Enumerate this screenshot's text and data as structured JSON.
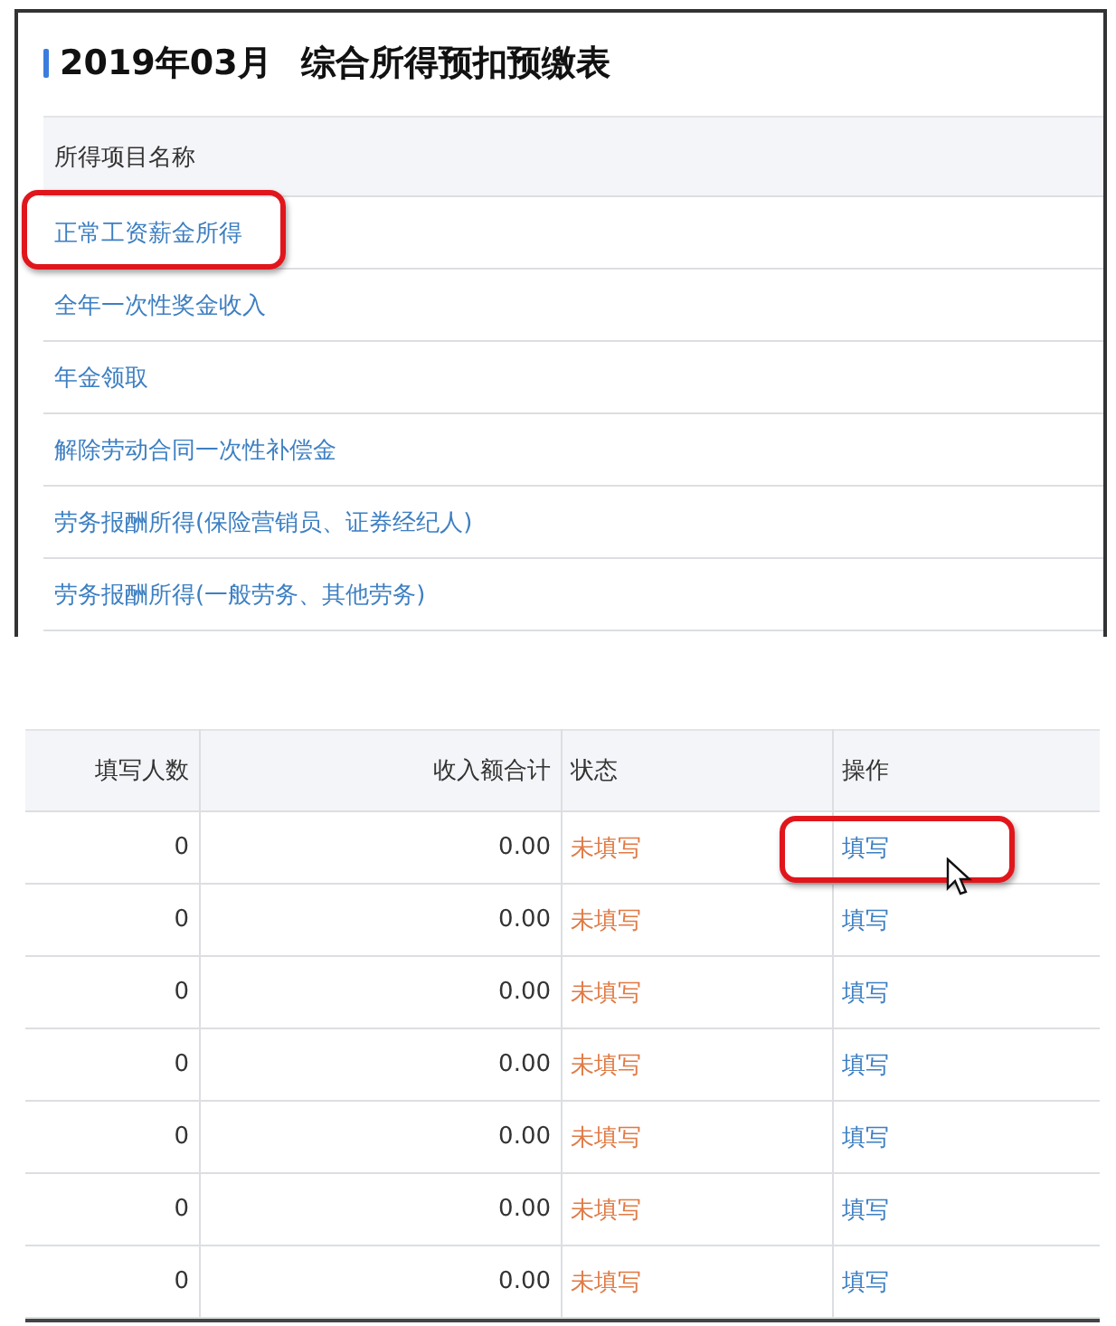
{
  "income_panel": {
    "title_period": "2019年03月",
    "title": "综合所得预扣预缴表",
    "column": "所得项目名称",
    "items": [
      {
        "label": "正常工资薪金所得",
        "highlighted": true
      },
      {
        "label": "全年一次性奖金收入",
        "highlighted": false
      },
      {
        "label": "年金领取",
        "highlighted": false
      },
      {
        "label": "解除劳动合同一次性补偿金",
        "highlighted": false
      },
      {
        "label": "劳务报酬所得(保险营销员、证券经纪人)",
        "highlighted": false
      },
      {
        "label": "劳务报酬所得(一般劳务、其他劳务)",
        "highlighted": false
      }
    ]
  },
  "summary_table": {
    "columns": [
      "填写人数",
      "收入额合计",
      "状态",
      "操作"
    ],
    "rows": [
      {
        "count": "0",
        "amount": "0.00",
        "status": "未填写",
        "action": "填写",
        "highlighted": true
      },
      {
        "count": "0",
        "amount": "0.00",
        "status": "未填写",
        "action": "填写",
        "highlighted": false
      },
      {
        "count": "0",
        "amount": "0.00",
        "status": "未填写",
        "action": "填写",
        "highlighted": false
      },
      {
        "count": "0",
        "amount": "0.00",
        "status": "未填写",
        "action": "填写",
        "highlighted": false
      },
      {
        "count": "0",
        "amount": "0.00",
        "status": "未填写",
        "action": "填写",
        "highlighted": false
      },
      {
        "count": "0",
        "amount": "0.00",
        "status": "未填写",
        "action": "填写",
        "highlighted": false
      },
      {
        "count": "0",
        "amount": "0.00",
        "status": "未填写",
        "action": "填写",
        "highlighted": false
      }
    ]
  }
}
